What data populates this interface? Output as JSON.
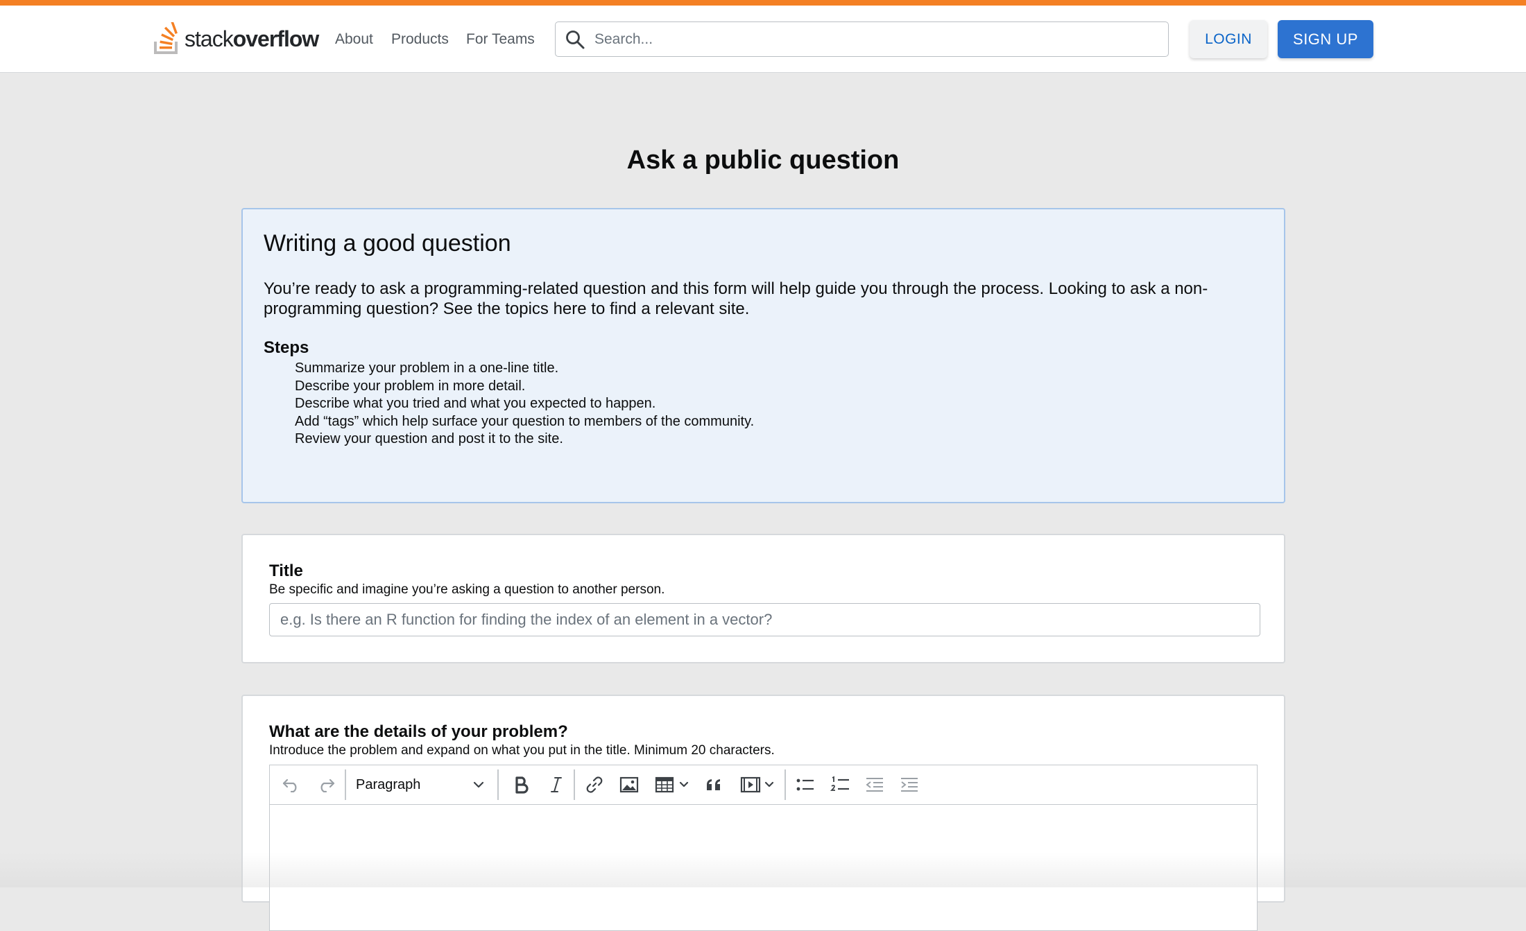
{
  "header": {
    "logo_light": "stack",
    "logo_bold": "overflow",
    "nav": [
      "About",
      "Products",
      "For Teams"
    ],
    "search_placeholder": "Search...",
    "login_label": "LOGIN",
    "signup_label": "SIGN UP"
  },
  "page": {
    "title": "Ask a public question"
  },
  "guide": {
    "title": "Writing a good question",
    "body": "You’re ready to ask a programming-related question and this form will help guide you through the process. Looking to ask a non-programming question? See the topics here to find a relevant site.",
    "steps_heading": "Steps",
    "steps": [
      "Summarize your problem in a one-line title.",
      "Describe your problem in more detail.",
      "Describe what you tried and what you expected to happen.",
      "Add “tags” which help surface your question to members of the community.",
      "Review your question and post it to the site."
    ]
  },
  "title_field": {
    "label": "Title",
    "description": "Be specific and imagine you’re asking a question to another person.",
    "placeholder": "e.g. Is there an R function for finding the index of an element in a vector?",
    "value": ""
  },
  "details_field": {
    "label": "What are the details of your problem?",
    "description": "Introduce the problem and expand on what you put in the title. Minimum 20 characters.",
    "block_format": "Paragraph"
  },
  "colors": {
    "accent_orange": "#f48024",
    "primary_blue": "#2d73d1",
    "link_blue": "#0a64c8",
    "guide_bg": "#ebf2fa",
    "guide_border": "#a6c5ea"
  },
  "icons": [
    "search-icon",
    "undo-icon",
    "redo-icon",
    "chevron-down-icon",
    "bold-icon",
    "italic-icon",
    "link-icon",
    "image-icon",
    "table-icon",
    "blockquote-icon",
    "media-embed-icon",
    "bulleted-list-icon",
    "numbered-list-icon",
    "outdent-icon",
    "indent-icon"
  ]
}
